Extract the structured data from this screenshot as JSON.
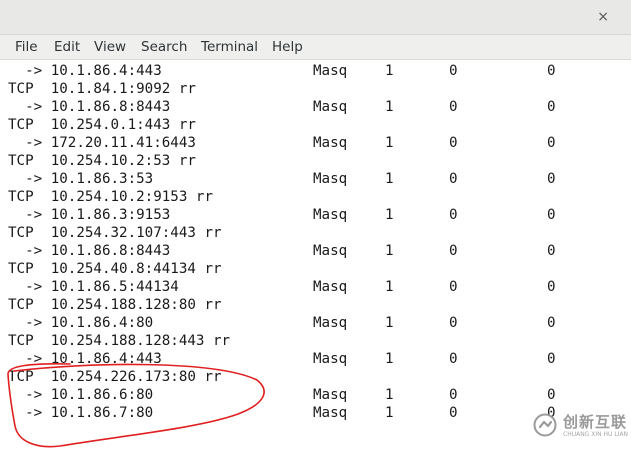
{
  "window": {
    "close_glyph": "×"
  },
  "menubar": [
    {
      "label": "File"
    },
    {
      "label": "Edit"
    },
    {
      "label": "View"
    },
    {
      "label": "Search"
    },
    {
      "label": "Terminal"
    },
    {
      "label": "Help"
    }
  ],
  "terminal": {
    "lines": [
      {
        "kind": "dest",
        "address": "  -> 10.1.86.4:443",
        "forward": "Masq",
        "weight": "1",
        "active": "0",
        "inactive": "0"
      },
      {
        "kind": "service",
        "text": "TCP  10.1.84.1:9092 rr"
      },
      {
        "kind": "dest",
        "address": "  -> 10.1.86.8:8443",
        "forward": "Masq",
        "weight": "1",
        "active": "0",
        "inactive": "0"
      },
      {
        "kind": "service",
        "text": "TCP  10.254.0.1:443 rr"
      },
      {
        "kind": "dest",
        "address": "  -> 172.20.11.41:6443",
        "forward": "Masq",
        "weight": "1",
        "active": "0",
        "inactive": "0"
      },
      {
        "kind": "service",
        "text": "TCP  10.254.10.2:53 rr"
      },
      {
        "kind": "dest",
        "address": "  -> 10.1.86.3:53",
        "forward": "Masq",
        "weight": "1",
        "active": "0",
        "inactive": "0"
      },
      {
        "kind": "service",
        "text": "TCP  10.254.10.2:9153 rr"
      },
      {
        "kind": "dest",
        "address": "  -> 10.1.86.3:9153",
        "forward": "Masq",
        "weight": "1",
        "active": "0",
        "inactive": "0"
      },
      {
        "kind": "service",
        "text": "TCP  10.254.32.107:443 rr"
      },
      {
        "kind": "dest",
        "address": "  -> 10.1.86.8:8443",
        "forward": "Masq",
        "weight": "1",
        "active": "0",
        "inactive": "0"
      },
      {
        "kind": "service",
        "text": "TCP  10.254.40.8:44134 rr"
      },
      {
        "kind": "dest",
        "address": "  -> 10.1.86.5:44134",
        "forward": "Masq",
        "weight": "1",
        "active": "0",
        "inactive": "0"
      },
      {
        "kind": "service",
        "text": "TCP  10.254.188.128:80 rr"
      },
      {
        "kind": "dest",
        "address": "  -> 10.1.86.4:80",
        "forward": "Masq",
        "weight": "1",
        "active": "0",
        "inactive": "0"
      },
      {
        "kind": "service",
        "text": "TCP  10.254.188.128:443 rr"
      },
      {
        "kind": "dest",
        "address": "  -> 10.1.86.4:443",
        "forward": "Masq",
        "weight": "1",
        "active": "0",
        "inactive": "0"
      },
      {
        "kind": "service",
        "text": "TCP  10.254.226.173:80 rr"
      },
      {
        "kind": "dest",
        "address": "  -> 10.1.86.6:80",
        "forward": "Masq",
        "weight": "1",
        "active": "0",
        "inactive": "0"
      },
      {
        "kind": "dest",
        "address": "  -> 10.1.86.7:80",
        "forward": "Masq",
        "weight": "1",
        "active": "0",
        "inactive": "0"
      }
    ]
  },
  "annotation": {
    "color": "#e02020"
  },
  "watermark": {
    "brand": "创新互联",
    "subtitle": "CHUANG XIN HU LIAN",
    "color": "#9a9a9a"
  }
}
